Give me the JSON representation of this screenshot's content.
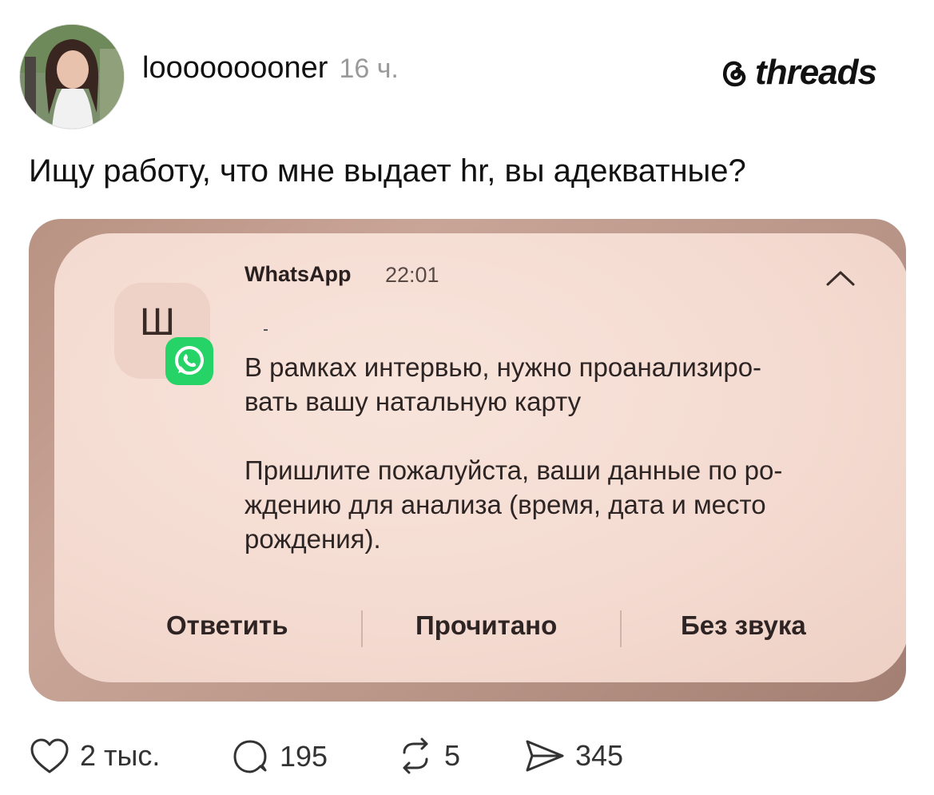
{
  "post": {
    "username": "looooooooner",
    "time": "16 ч.",
    "text": "Ищу работу, что мне выдает hr, вы адекватные?"
  },
  "brand": {
    "name": "threads"
  },
  "notification": {
    "app_name": "WhatsApp",
    "time": "22:01",
    "sender_initial": "Ш",
    "message_1": "В рамках интервью, нужно проанализиро-\nвать вашу натальную карту",
    "message_2": "Пришлите пожалуйста, ваши данные по ро-\nждению для анализа (время, дата и место\nрождения).",
    "actions": [
      "Ответить",
      "Прочитано",
      "Без звука"
    ]
  },
  "stats": {
    "likes": "2 тыс.",
    "replies": "195",
    "reposts": "5",
    "shares": "345"
  },
  "colors": {
    "whatsapp_green": "#25D366",
    "notification_bg": "#F4DBD1",
    "frame_bg": "#C9A598"
  },
  "icons": [
    "avatar",
    "threads-logo-icon",
    "whatsapp-icon",
    "chevron-up-icon",
    "heart-icon",
    "comment-icon",
    "repost-icon",
    "share-icon"
  ]
}
